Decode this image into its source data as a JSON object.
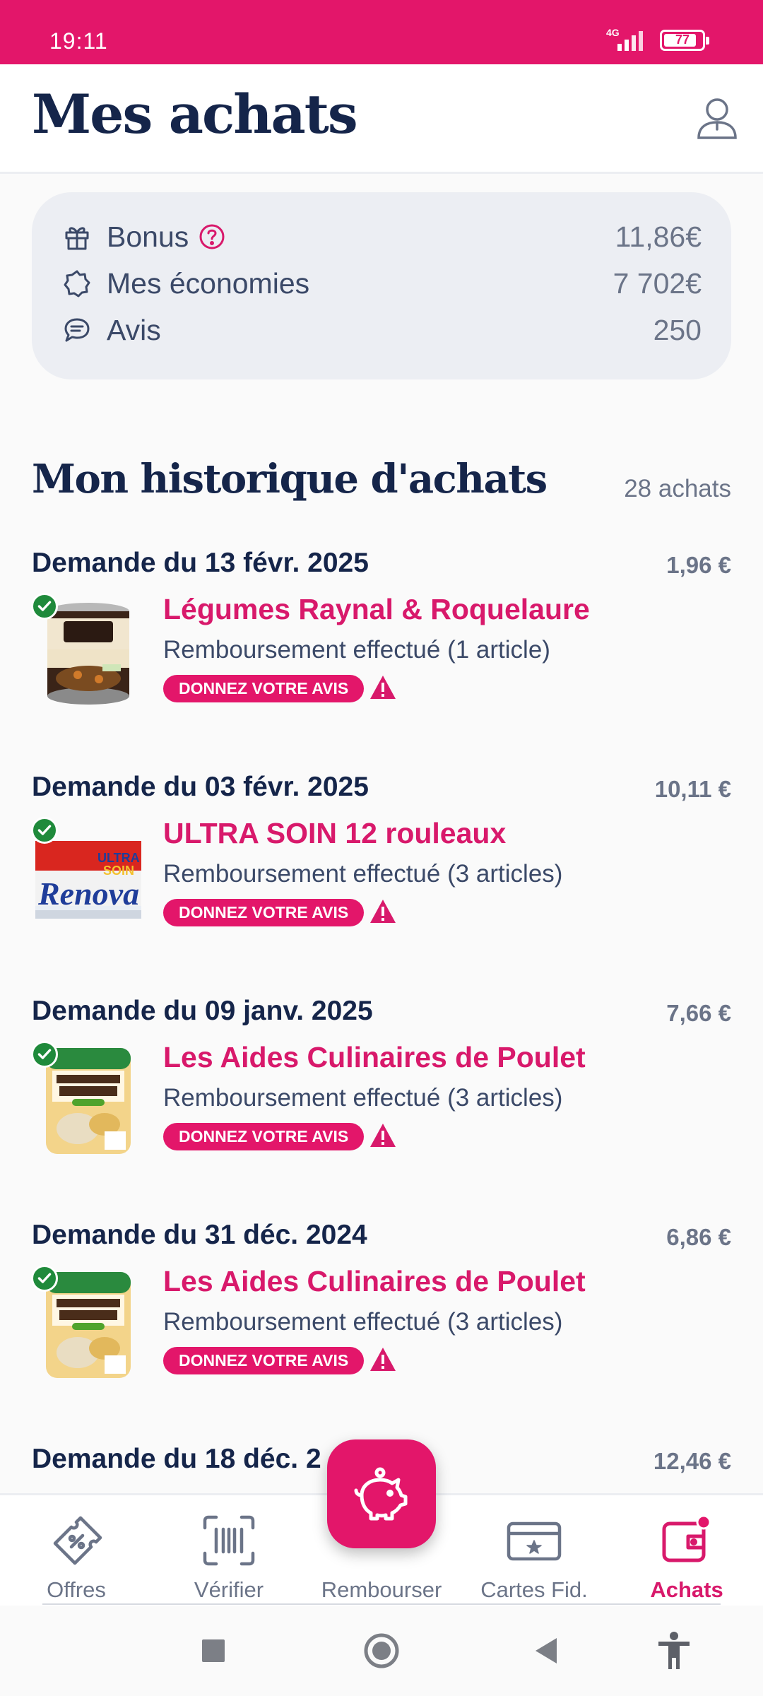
{
  "status_bar": {
    "time": "19:11",
    "network": "4G",
    "battery": "77"
  },
  "header": {
    "title": "Mes achats",
    "profile_icon": "user-icon"
  },
  "summary": {
    "bonus": {
      "label": "Bonus",
      "value": "11,86€",
      "icon": "gift-icon"
    },
    "savings": {
      "label": "Mes économies",
      "value": "7 702€",
      "icon": "badge-icon"
    },
    "reviews": {
      "label": "Avis",
      "value": "250",
      "icon": "chat-icon"
    }
  },
  "history": {
    "title": "Mon historique d'achats",
    "count": "28 achats",
    "entries": [
      {
        "date": "Demande du 13 févr. 2025",
        "amount": "1,96 €",
        "name": "Légumes Raynal & Roquelaure",
        "status": "Remboursement effectué (1 article)",
        "button": "DONNEZ VOTRE AVIS"
      },
      {
        "date": "Demande du 03 févr. 2025",
        "amount": "10,11 €",
        "name": "ULTRA SOIN 12 rouleaux",
        "status": "Remboursement effectué (3 articles)",
        "button": "DONNEZ VOTRE AVIS"
      },
      {
        "date": "Demande du 09 janv. 2025",
        "amount": "7,66 €",
        "name": "Les Aides Culinaires de Poulet",
        "status": "Remboursement effectué (3 articles)",
        "button": "DONNEZ VOTRE AVIS"
      },
      {
        "date": "Demande du 31 déc. 2024",
        "amount": "6,86 €",
        "name": "Les Aides Culinaires de Poulet",
        "status": "Remboursement effectué (3 articles)",
        "button": "DONNEZ VOTRE AVIS"
      },
      {
        "date": "Demande du 18 déc. 2",
        "amount": "12,46 €"
      }
    ]
  },
  "nav": {
    "tabs": [
      {
        "label": "Offres",
        "icon": "coupon-icon"
      },
      {
        "label": "Vérifier",
        "icon": "barcode-scan-icon"
      },
      {
        "label": "Rembourser",
        "icon": "piggy-bank-icon"
      },
      {
        "label": "Cartes Fid.",
        "icon": "loyalty-card-icon"
      },
      {
        "label": "Achats",
        "icon": "wallet-icon"
      }
    ],
    "active": "Achats",
    "accent": "#e3166a"
  },
  "colors": {
    "brand": "#e3166a",
    "title": "#15254a",
    "muted": "#6b7488",
    "success": "#1f8a3b"
  }
}
